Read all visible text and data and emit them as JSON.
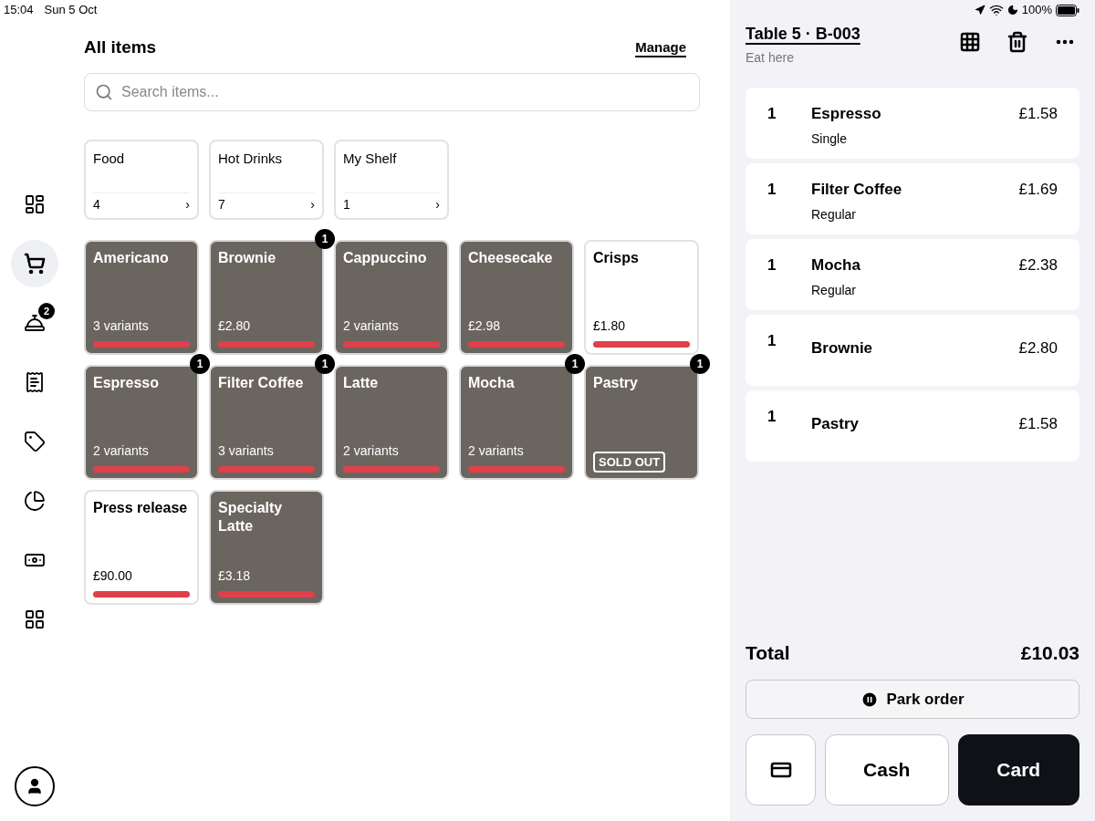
{
  "status_bar": {
    "time": "15:04",
    "date": "Sun 5 Oct",
    "battery": "100%"
  },
  "sidebar": {
    "items": [
      {
        "selected": false
      },
      {
        "selected": true
      },
      {
        "selected": false,
        "badge": "2"
      },
      {
        "selected": false
      },
      {
        "selected": false
      },
      {
        "selected": false
      },
      {
        "selected": false
      },
      {
        "selected": false
      }
    ]
  },
  "header": {
    "title": "All items",
    "action": "Manage"
  },
  "search": {
    "placeholder": "Search items..."
  },
  "categories": [
    {
      "name": "Food",
      "count": "4",
      "arrow": "›"
    },
    {
      "name": "Hot Drinks",
      "count": "7",
      "arrow": "›"
    },
    {
      "name": "My Shelf",
      "count": "1",
      "arrow": "›"
    }
  ],
  "items": [
    {
      "kind": "photo",
      "name": "Americano",
      "sub": "3 variants"
    },
    {
      "kind": "photo",
      "name": "Brownie",
      "sub": "£2.80",
      "badge": "1"
    },
    {
      "kind": "photo",
      "name": "Cappuccino",
      "sub": "2 variants"
    },
    {
      "kind": "photo",
      "name": "Cheesecake",
      "sub": "£2.98"
    },
    {
      "kind": "plain",
      "name": "Crisps",
      "sub": "£1.80"
    },
    {
      "kind": "photo",
      "name": "Espresso",
      "sub": "2 variants",
      "badge": "1"
    },
    {
      "kind": "photo",
      "name": "Filter Coffee",
      "sub": "3 variants",
      "badge": "1"
    },
    {
      "kind": "photo",
      "name": "Latte",
      "sub": "2 variants"
    },
    {
      "kind": "photo",
      "name": "Mocha",
      "sub": "2 variants",
      "badge": "1"
    },
    {
      "kind": "photo",
      "name": "Pastry",
      "tag": "SOLD OUT",
      "badge": "1"
    },
    {
      "kind": "plain",
      "name": "Press release",
      "sub": "£90.00"
    },
    {
      "kind": "photo",
      "name": "Specialty Latte",
      "sub": "£3.18"
    }
  ],
  "order": {
    "title": "Table 5 · B-003",
    "subtitle": "Eat here",
    "lines": [
      {
        "qty": "1",
        "name": "Espresso",
        "option": "Single",
        "price": "£1.58"
      },
      {
        "qty": "1",
        "name": "Filter Coffee",
        "option": "Regular",
        "price": "£1.69"
      },
      {
        "qty": "1",
        "name": "Mocha",
        "option": "Regular",
        "price": "£2.38"
      },
      {
        "qty": "1",
        "name": "Brownie",
        "price": "£2.80"
      },
      {
        "qty": "1",
        "name": "Pastry",
        "price": "£1.58"
      }
    ],
    "total_label": "Total",
    "total": "£10.03",
    "park": "Park order",
    "cash": "Cash",
    "card": "Card"
  }
}
